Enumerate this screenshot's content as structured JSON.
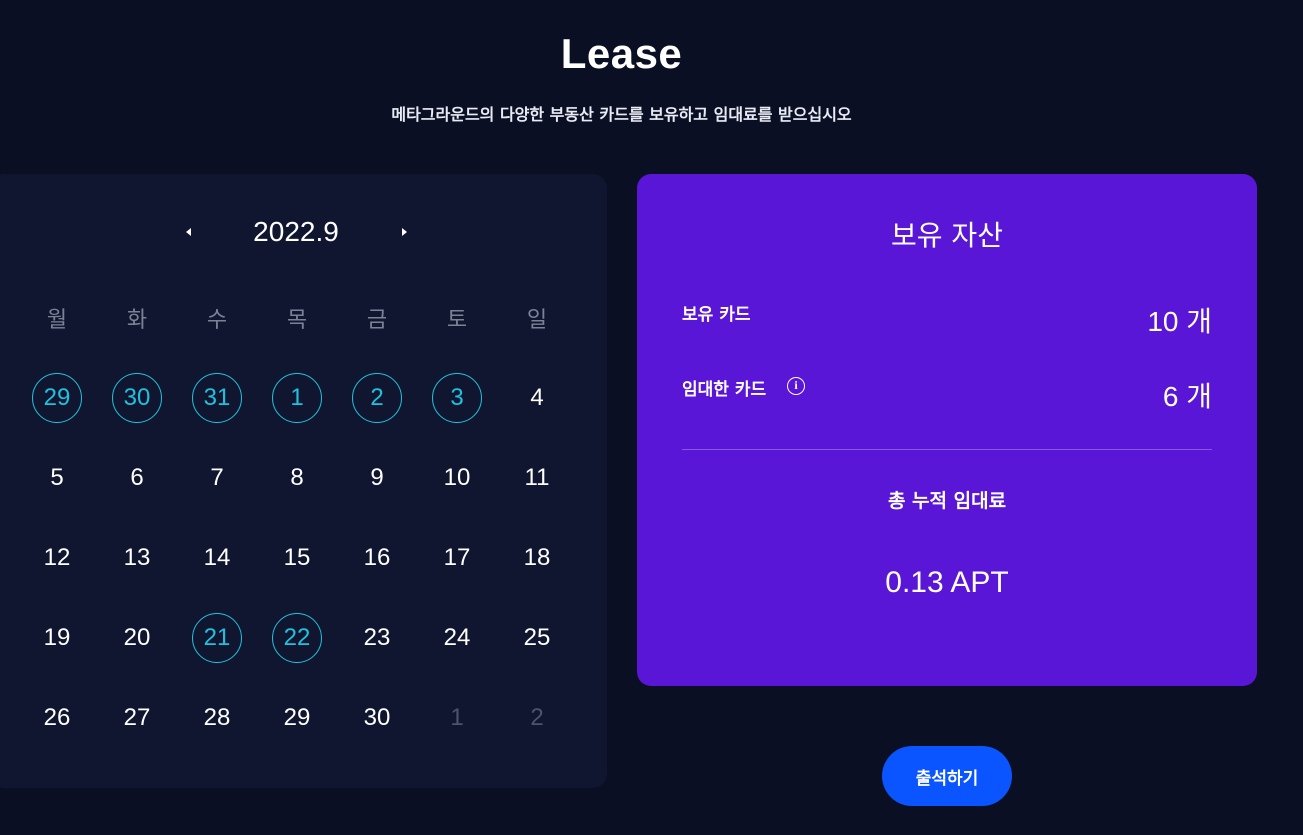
{
  "header": {
    "title": "Lease",
    "subtitle": "메타그라운드의 다양한 부동산 카드를 보유하고 임대료를 받으십시오"
  },
  "calendar": {
    "month_label": "2022.9",
    "prev_icon": "chevron-left-icon",
    "next_icon": "chevron-right-icon",
    "weekdays": [
      "월",
      "화",
      "수",
      "목",
      "금",
      "토",
      "일"
    ],
    "days": [
      {
        "n": "29",
        "state": "attended"
      },
      {
        "n": "30",
        "state": "attended"
      },
      {
        "n": "31",
        "state": "attended"
      },
      {
        "n": "1",
        "state": "attended"
      },
      {
        "n": "2",
        "state": "attended"
      },
      {
        "n": "3",
        "state": "attended"
      },
      {
        "n": "4",
        "state": "normal"
      },
      {
        "n": "5",
        "state": "normal"
      },
      {
        "n": "6",
        "state": "normal"
      },
      {
        "n": "7",
        "state": "normal"
      },
      {
        "n": "8",
        "state": "normal"
      },
      {
        "n": "9",
        "state": "normal"
      },
      {
        "n": "10",
        "state": "normal"
      },
      {
        "n": "11",
        "state": "normal"
      },
      {
        "n": "12",
        "state": "normal"
      },
      {
        "n": "13",
        "state": "normal"
      },
      {
        "n": "14",
        "state": "normal"
      },
      {
        "n": "15",
        "state": "normal"
      },
      {
        "n": "16",
        "state": "normal"
      },
      {
        "n": "17",
        "state": "normal"
      },
      {
        "n": "18",
        "state": "normal"
      },
      {
        "n": "19",
        "state": "normal"
      },
      {
        "n": "20",
        "state": "normal"
      },
      {
        "n": "21",
        "state": "attended"
      },
      {
        "n": "22",
        "state": "attended"
      },
      {
        "n": "23",
        "state": "normal"
      },
      {
        "n": "24",
        "state": "normal"
      },
      {
        "n": "25",
        "state": "normal"
      },
      {
        "n": "26",
        "state": "normal"
      },
      {
        "n": "27",
        "state": "normal"
      },
      {
        "n": "28",
        "state": "normal"
      },
      {
        "n": "29",
        "state": "normal"
      },
      {
        "n": "30",
        "state": "normal"
      },
      {
        "n": "1",
        "state": "muted"
      },
      {
        "n": "2",
        "state": "muted"
      }
    ]
  },
  "assets": {
    "title": "보유 자산",
    "owned_label": "보유 카드",
    "owned_value": "10 개",
    "leased_label": "임대한 카드",
    "leased_info_icon": "info-icon",
    "leased_value": "6 개",
    "total_label": "총 누적 임대료",
    "total_value": "0.13 APT"
  },
  "actions": {
    "attend_label": "출석하기"
  },
  "colors": {
    "background": "#0a0f23",
    "calendar_panel": "#101630",
    "assets_card": "#5a16d6",
    "attended_ring": "#1ec2de",
    "button": "#0a55ff"
  }
}
